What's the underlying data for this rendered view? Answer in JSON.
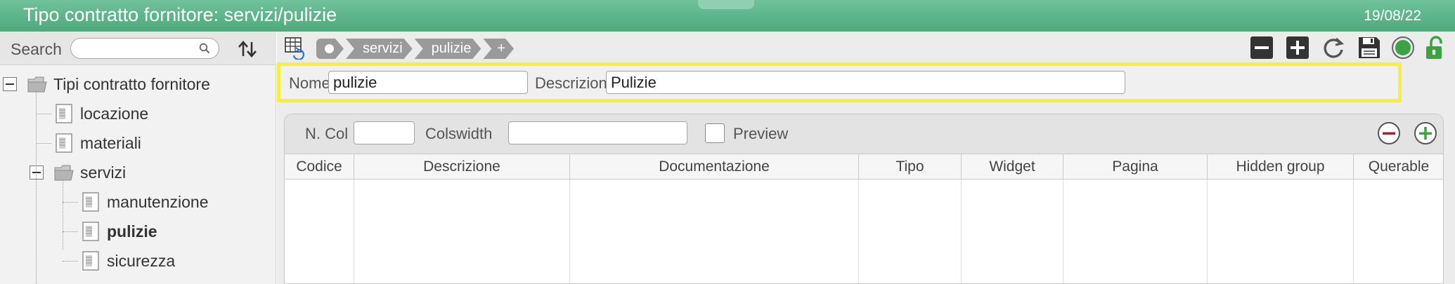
{
  "window": {
    "title": "Tipo contratto fornitore: servizi/pulizie",
    "date": "19/08/22"
  },
  "sidebar": {
    "search_label": "Search",
    "search_value": "",
    "tree": [
      {
        "label": "Tipi contratto fornitore",
        "level": 0,
        "type": "folder",
        "expanded": true,
        "bold": false
      },
      {
        "label": "locazione",
        "level": 1,
        "type": "doc",
        "bold": false
      },
      {
        "label": "materiali",
        "level": 1,
        "type": "doc",
        "bold": false
      },
      {
        "label": "servizi",
        "level": 1,
        "type": "folder",
        "expanded": true,
        "bold": false
      },
      {
        "label": "manutenzione",
        "level": 2,
        "type": "doc",
        "bold": false
      },
      {
        "label": "pulizie",
        "level": 2,
        "type": "doc",
        "bold": true
      },
      {
        "label": "sicurezza",
        "level": 2,
        "type": "doc",
        "bold": false
      }
    ]
  },
  "toolbar": {
    "breadcrumbs": [
      "servizi",
      "pulizie"
    ],
    "breadcrumb_add": "+",
    "icons": [
      "table-view-icon",
      "minus-square-icon",
      "plus-square-icon",
      "refresh-icon",
      "save-icon",
      "status-dot-icon",
      "unlock-icon"
    ],
    "accent_green": "#4fa97d",
    "status_green": "#3ca244",
    "highlight_yellow": "#f7ef3b"
  },
  "form": {
    "nome_label": "Nome",
    "nome_value": "pulizie",
    "descrizione_label": "Descrizione",
    "descrizione_value": "Pulizie"
  },
  "grid": {
    "ncol_label": "N. Col",
    "ncol_value": "",
    "colswidth_label": "Colswidth",
    "colswidth_value": "",
    "preview_label": "Preview",
    "preview_checked": false,
    "columns": [
      "Codice",
      "Descrizione",
      "Documentazione",
      "Tipo",
      "Widget",
      "Pagina",
      "Hidden group",
      "Querable"
    ],
    "rows": []
  }
}
